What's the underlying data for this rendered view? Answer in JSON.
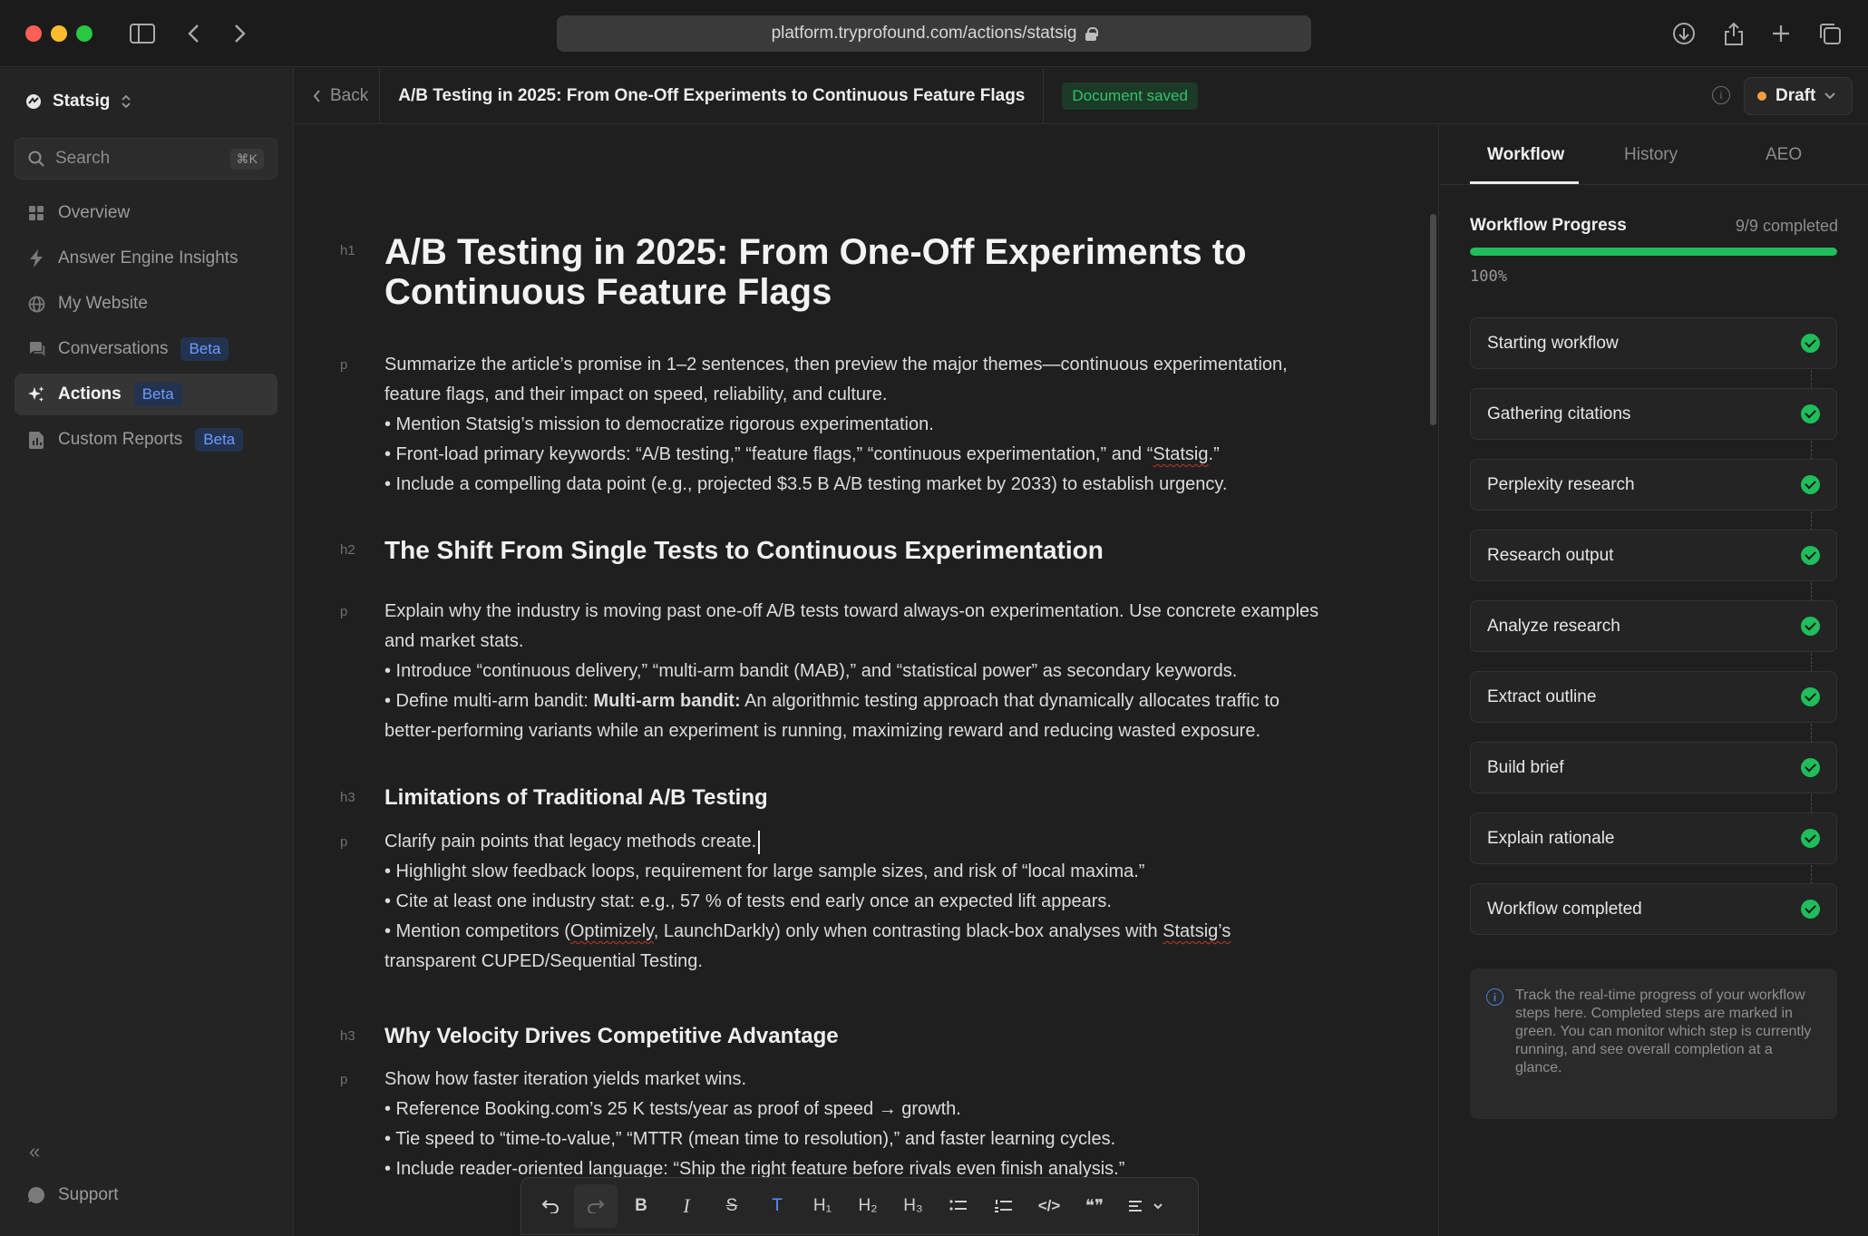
{
  "browser": {
    "url": "platform.tryprofound.com/actions/statsig"
  },
  "sidebar": {
    "workspace": "Statsig",
    "search_placeholder": "Search",
    "search_shortcut": "⌘K",
    "items": [
      {
        "label": "Overview",
        "icon": "grid-icon",
        "active": false
      },
      {
        "label": "Answer Engine Insights",
        "icon": "bolt-icon",
        "active": false
      },
      {
        "label": "My Website",
        "icon": "globe-icon",
        "active": false
      },
      {
        "label": "Conversations",
        "icon": "chat-icon",
        "active": false,
        "badge": "Beta"
      },
      {
        "label": "Actions",
        "icon": "sparkle-icon",
        "active": true,
        "badge": "Beta"
      },
      {
        "label": "Custom Reports",
        "icon": "report-icon",
        "active": false,
        "badge": "Beta"
      }
    ],
    "support": "Support"
  },
  "topbar": {
    "back": "Back",
    "title": "A/B Testing in 2025: From One-Off Experiments to Continuous Feature Flags",
    "saved": "Document saved",
    "status": "Draft"
  },
  "document": {
    "h1": "A/B Testing in 2025: From One-Off Experiments to Continuous Feature Flags",
    "p1": [
      "Summarize the article’s promise in 1–2 sentences, then preview the major themes—continuous experimentation, feature flags, and their impact on speed, reliability, and culture.",
      "• Mention Statsig’s mission to democratize rigorous experimentation.",
      "• Front-load primary keywords: “A/B testing,” “feature flags,” “continuous experimentation,” and “",
      "Statsig",
      ".”",
      "• Include a compelling data point (e.g., projected $3.5 B A/B testing market by 2033) to establish urgency."
    ],
    "h2": "The Shift From Single Tests to Continuous Experimentation",
    "p2": [
      "Explain why the industry is moving past one-off A/B tests toward always-on experimentation. Use concrete examples and market stats.",
      "• Introduce “continuous delivery,” “multi-arm bandit (MAB),” and “statistical power” as secondary keywords.",
      "• Define multi-arm bandit: ",
      "Multi-arm bandit:",
      " An algorithmic testing approach that dynamically allocates traffic to better-performing variants while an experiment is running, maximizing reward and reducing wasted exposure."
    ],
    "h3a": "Limitations of Traditional A/B Testing",
    "p3": [
      "Clarify pain points that legacy methods create.",
      "• Highlight slow feedback loops, requirement for large sample sizes, and risk of “local maxima.”",
      "• Cite at least one industry stat: e.g., 57 % of tests end early once an expected lift appears.",
      "• Mention competitors (",
      "Optimizely",
      ", LaunchDarkly) only when contrasting black-box analyses with ",
      "Statsig’s",
      " transparent CUPED/Sequential Testing."
    ],
    "h3b": "Why Velocity Drives Competitive Advantage",
    "p4": [
      "Show how faster iteration yields market wins.",
      "• Reference Booking.com’s 25 K tests/year as proof of speed → growth.",
      "• Tie speed to “time-to-value,” “MTTR (mean time to resolution),” and faster learning cycles.",
      "• Include reader-oriented language: “Ship the right feature before rivals even finish analysis.”"
    ],
    "tags": {
      "h1": "h1",
      "h2": "h2",
      "h3": "h3",
      "p": "p"
    }
  },
  "toolbar": {
    "items": [
      "undo-icon",
      "redo-icon",
      "bold-icon",
      "italic-icon",
      "strike-icon",
      "text-icon",
      "h1-icon",
      "h2-icon",
      "h3-icon",
      "bullet-list-icon",
      "ordered-list-icon",
      "code-icon",
      "quote-icon",
      "align-icon"
    ],
    "labels": {
      "bold": "B",
      "italic": "I",
      "strike": "S",
      "text": "T",
      "h1": "H₁",
      "h2": "H₂",
      "h3": "H₃",
      "code": "</>",
      "quote": "❝❞"
    }
  },
  "panel": {
    "tabs": [
      "Workflow",
      "History",
      "AEO"
    ],
    "progress_title": "Workflow Progress",
    "progress_count": "9/9 completed",
    "progress_pct_label": "100%",
    "progress_value": 1.0,
    "steps": [
      "Starting workflow",
      "Gathering citations",
      "Perplexity research",
      "Research output",
      "Analyze research",
      "Extract outline",
      "Build brief",
      "Explain rationale",
      "Workflow completed"
    ],
    "note": "Track the real-time progress of your workflow steps here. Completed steps are marked in green. You can monitor which step is currently running, and see overall completion at a glance."
  },
  "colors": {
    "accent_green": "#1fbd5b",
    "beta_blue": "#6c9bff",
    "draft_orange": "#f59e3c"
  }
}
